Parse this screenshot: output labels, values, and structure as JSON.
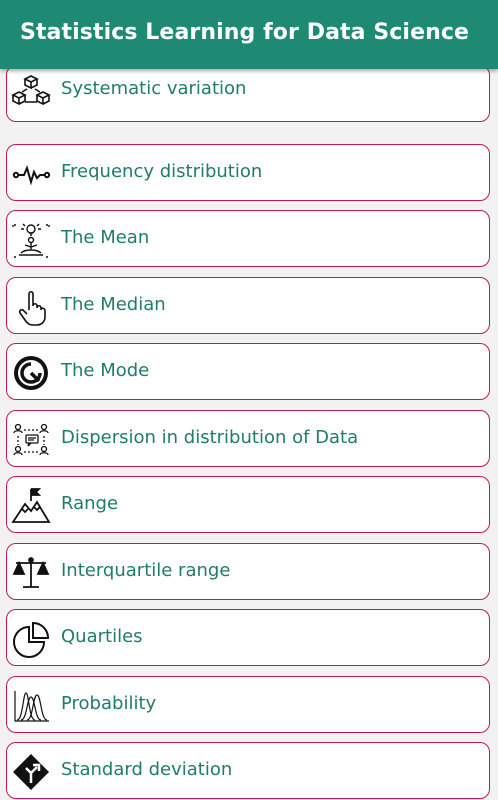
{
  "app": {
    "title": "Statistics Learning for Data Science"
  },
  "list": {
    "items": [
      {
        "label": "Systematic variation",
        "icon": "cubes-network-icon"
      },
      {
        "label": "Frequency distribution",
        "icon": "heartbeat-pulse-icon"
      },
      {
        "label": "The Mean",
        "icon": "meditation-idea-icon"
      },
      {
        "label": "The Median",
        "icon": "hand-pointer-icon"
      },
      {
        "label": "The Mode",
        "icon": "mode-circle-icon"
      },
      {
        "label": "Dispersion in distribution of Data",
        "icon": "people-network-chat-icon"
      },
      {
        "label": "Range",
        "icon": "mountain-flag-icon"
      },
      {
        "label": "Interquartile range",
        "icon": "balance-scale-icon"
      },
      {
        "label": "Quartiles",
        "icon": "pie-chart-icon"
      },
      {
        "label": "Probability",
        "icon": "distribution-curves-icon"
      },
      {
        "label": "Standard deviation",
        "icon": "road-sign-icon"
      }
    ]
  },
  "colors": {
    "appbar": "#1f8a74",
    "label": "#1f7d69",
    "card_border": "#c2185b"
  }
}
